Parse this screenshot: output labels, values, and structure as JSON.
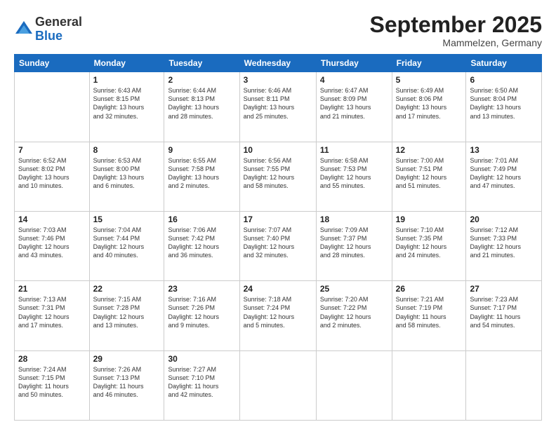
{
  "logo": {
    "general": "General",
    "blue": "Blue"
  },
  "title": "September 2025",
  "subtitle": "Mammelzen, Germany",
  "days_header": [
    "Sunday",
    "Monday",
    "Tuesday",
    "Wednesday",
    "Thursday",
    "Friday",
    "Saturday"
  ],
  "weeks": [
    [
      {
        "day": "",
        "info": ""
      },
      {
        "day": "1",
        "info": "Sunrise: 6:43 AM\nSunset: 8:15 PM\nDaylight: 13 hours\nand 32 minutes."
      },
      {
        "day": "2",
        "info": "Sunrise: 6:44 AM\nSunset: 8:13 PM\nDaylight: 13 hours\nand 28 minutes."
      },
      {
        "day": "3",
        "info": "Sunrise: 6:46 AM\nSunset: 8:11 PM\nDaylight: 13 hours\nand 25 minutes."
      },
      {
        "day": "4",
        "info": "Sunrise: 6:47 AM\nSunset: 8:09 PM\nDaylight: 13 hours\nand 21 minutes."
      },
      {
        "day": "5",
        "info": "Sunrise: 6:49 AM\nSunset: 8:06 PM\nDaylight: 13 hours\nand 17 minutes."
      },
      {
        "day": "6",
        "info": "Sunrise: 6:50 AM\nSunset: 8:04 PM\nDaylight: 13 hours\nand 13 minutes."
      }
    ],
    [
      {
        "day": "7",
        "info": "Sunrise: 6:52 AM\nSunset: 8:02 PM\nDaylight: 13 hours\nand 10 minutes."
      },
      {
        "day": "8",
        "info": "Sunrise: 6:53 AM\nSunset: 8:00 PM\nDaylight: 13 hours\nand 6 minutes."
      },
      {
        "day": "9",
        "info": "Sunrise: 6:55 AM\nSunset: 7:58 PM\nDaylight: 13 hours\nand 2 minutes."
      },
      {
        "day": "10",
        "info": "Sunrise: 6:56 AM\nSunset: 7:55 PM\nDaylight: 12 hours\nand 58 minutes."
      },
      {
        "day": "11",
        "info": "Sunrise: 6:58 AM\nSunset: 7:53 PM\nDaylight: 12 hours\nand 55 minutes."
      },
      {
        "day": "12",
        "info": "Sunrise: 7:00 AM\nSunset: 7:51 PM\nDaylight: 12 hours\nand 51 minutes."
      },
      {
        "day": "13",
        "info": "Sunrise: 7:01 AM\nSunset: 7:49 PM\nDaylight: 12 hours\nand 47 minutes."
      }
    ],
    [
      {
        "day": "14",
        "info": "Sunrise: 7:03 AM\nSunset: 7:46 PM\nDaylight: 12 hours\nand 43 minutes."
      },
      {
        "day": "15",
        "info": "Sunrise: 7:04 AM\nSunset: 7:44 PM\nDaylight: 12 hours\nand 40 minutes."
      },
      {
        "day": "16",
        "info": "Sunrise: 7:06 AM\nSunset: 7:42 PM\nDaylight: 12 hours\nand 36 minutes."
      },
      {
        "day": "17",
        "info": "Sunrise: 7:07 AM\nSunset: 7:40 PM\nDaylight: 12 hours\nand 32 minutes."
      },
      {
        "day": "18",
        "info": "Sunrise: 7:09 AM\nSunset: 7:37 PM\nDaylight: 12 hours\nand 28 minutes."
      },
      {
        "day": "19",
        "info": "Sunrise: 7:10 AM\nSunset: 7:35 PM\nDaylight: 12 hours\nand 24 minutes."
      },
      {
        "day": "20",
        "info": "Sunrise: 7:12 AM\nSunset: 7:33 PM\nDaylight: 12 hours\nand 21 minutes."
      }
    ],
    [
      {
        "day": "21",
        "info": "Sunrise: 7:13 AM\nSunset: 7:31 PM\nDaylight: 12 hours\nand 17 minutes."
      },
      {
        "day": "22",
        "info": "Sunrise: 7:15 AM\nSunset: 7:28 PM\nDaylight: 12 hours\nand 13 minutes."
      },
      {
        "day": "23",
        "info": "Sunrise: 7:16 AM\nSunset: 7:26 PM\nDaylight: 12 hours\nand 9 minutes."
      },
      {
        "day": "24",
        "info": "Sunrise: 7:18 AM\nSunset: 7:24 PM\nDaylight: 12 hours\nand 5 minutes."
      },
      {
        "day": "25",
        "info": "Sunrise: 7:20 AM\nSunset: 7:22 PM\nDaylight: 12 hours\nand 2 minutes."
      },
      {
        "day": "26",
        "info": "Sunrise: 7:21 AM\nSunset: 7:19 PM\nDaylight: 11 hours\nand 58 minutes."
      },
      {
        "day": "27",
        "info": "Sunrise: 7:23 AM\nSunset: 7:17 PM\nDaylight: 11 hours\nand 54 minutes."
      }
    ],
    [
      {
        "day": "28",
        "info": "Sunrise: 7:24 AM\nSunset: 7:15 PM\nDaylight: 11 hours\nand 50 minutes."
      },
      {
        "day": "29",
        "info": "Sunrise: 7:26 AM\nSunset: 7:13 PM\nDaylight: 11 hours\nand 46 minutes."
      },
      {
        "day": "30",
        "info": "Sunrise: 7:27 AM\nSunset: 7:10 PM\nDaylight: 11 hours\nand 42 minutes."
      },
      {
        "day": "",
        "info": ""
      },
      {
        "day": "",
        "info": ""
      },
      {
        "day": "",
        "info": ""
      },
      {
        "day": "",
        "info": ""
      }
    ]
  ]
}
